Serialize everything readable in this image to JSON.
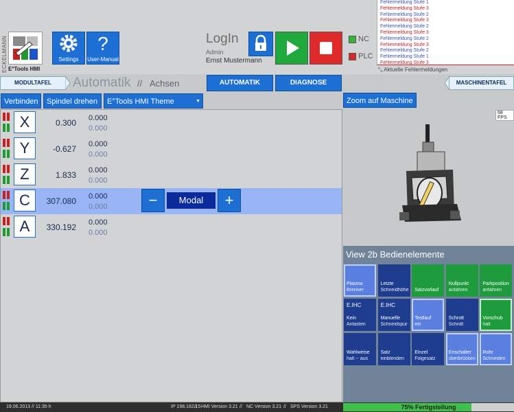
{
  "brand": {
    "vertical": "ECKELMANN",
    "name": "E°Tools HMI"
  },
  "toolbar": {
    "settings_label": "Settings",
    "manual_label": "User-Manual"
  },
  "login": {
    "title": "LogIn",
    "role": "Admin",
    "user": "Ernst Mustermann"
  },
  "indicators": {
    "nc_label": "NC",
    "plc_label": "PLC",
    "nc_color": "#35b43c",
    "plc_color": "#d82a2a"
  },
  "errors": {
    "items": [
      {
        "text": "Fehlermeldung Stufe 1",
        "level": 1
      },
      {
        "text": "Fehlermeldung Stufe 3",
        "level": 3
      },
      {
        "text": "Fehlermeldung Stufe 2",
        "level": 2
      },
      {
        "text": "Fehlermeldung Stufe 3",
        "level": 3
      },
      {
        "text": "Fehlermeldung Stufe 2",
        "level": 2
      },
      {
        "text": "Fehlermeldung Stufe 3",
        "level": 3
      },
      {
        "text": "Fehlermeldung Stufe 2",
        "level": 2
      },
      {
        "text": "Fehlermeldung Stufe 3",
        "level": 3
      },
      {
        "text": "Fehlermeldung Stufe 2",
        "level": 2
      },
      {
        "text": "Fehlermeldung Stufe 1",
        "level": 1
      },
      {
        "text": "Fehlermeldung Stufe 3",
        "level": 3
      }
    ],
    "footer": "Aktuelle Fehlermeldungen",
    "colors": {
      "1": "#3a50b0",
      "2": "#3a50b0",
      "3": "#c0202a"
    }
  },
  "nav": {
    "modultafel": "MODULTAFEL",
    "crumb_main": "Automatik",
    "crumb_sep": "//",
    "crumb_sub": "Achsen",
    "tab_automatik": "AUTOMATIK",
    "tab_diagnose": "DIAGNOSE",
    "maschinentafel": "MASCHINENTAFEL"
  },
  "controls": {
    "connect": "Verbinden",
    "spindle": "Spindel drehen",
    "theme": "E°Tools HMI Theme",
    "zoom": "Zoom auf Maschine"
  },
  "axes": [
    {
      "name": "X",
      "value": "0.300",
      "s1": "0.000",
      "s2": "0.000",
      "active": false
    },
    {
      "name": "Y",
      "value": "-0.627",
      "s1": "0.000",
      "s2": "0.000",
      "active": false
    },
    {
      "name": "Z",
      "value": "1.833",
      "s1": "0.000",
      "s2": "0.000",
      "active": false
    },
    {
      "name": "C",
      "value": "307.080",
      "s1": "0.000",
      "s2": "0.000",
      "active": true
    },
    {
      "name": "A",
      "value": "330.192",
      "s1": "0.000",
      "s2": "0.000",
      "active": false
    }
  ],
  "modal": {
    "minus": "−",
    "label": "Modal",
    "plus": "+"
  },
  "machine": {
    "fps": "68 FPS"
  },
  "bedien": {
    "title": "View 2b Bedienelemente",
    "tiles": [
      {
        "top": "",
        "l1": "Plasma",
        "l2": "Brenner",
        "bg": "#5a7fe0",
        "border": "#bcd0ff"
      },
      {
        "top": "",
        "l1": "Letzte",
        "l2": "Schneidhöhe",
        "bg": "#1f3d8f",
        "border": "#1f3d8f"
      },
      {
        "top": "",
        "l1": "Satzvorlauf",
        "l2": "",
        "bg": "#1e9b3c",
        "border": "#1e9b3c"
      },
      {
        "top": "",
        "l1": "Nullpunkt",
        "l2": "anfahren",
        "bg": "#1e9b3c",
        "border": "#1e9b3c"
      },
      {
        "top": "",
        "l1": "Parkposition",
        "l2": "anfahren",
        "bg": "#1e9b3c",
        "border": "#1e9b3c"
      },
      {
        "top": "E.IHC",
        "l1": "Kein",
        "l2": "Antasten",
        "bg": "#1f3d8f",
        "border": "#1f3d8f"
      },
      {
        "top": "E.IHC",
        "l1": "Manuelle",
        "l2": "Schneidspur",
        "bg": "#1f3d8f",
        "border": "#1f3d8f"
      },
      {
        "top": "",
        "l1": "Testlauf",
        "l2": "ein",
        "bg": "#5a7fe0",
        "border": "#bcd0ff"
      },
      {
        "top": "",
        "l1": "Schrott",
        "l2": "Schnitt",
        "bg": "#1f3d8f",
        "border": "#1f3d8f"
      },
      {
        "top": "",
        "l1": "Vorschub",
        "l2": "halt",
        "bg": "#1e9b3c",
        "border": "#bff0c8"
      },
      {
        "top": "",
        "l1": "Wahlweise",
        "l2": "halt -- aus",
        "bg": "#1f3d8f",
        "border": "#1f3d8f"
      },
      {
        "top": "",
        "l1": "Satz",
        "l2": "einblenden",
        "bg": "#1f3d8f",
        "border": "#1f3d8f"
      },
      {
        "top": "",
        "l1": "Einzel",
        "l2": "Folgesatz",
        "bg": "#1f3d8f",
        "border": "#1f3d8f"
      },
      {
        "top": "",
        "l1": "Enschalter",
        "l2": "überbrücken",
        "bg": "#5a7fe0",
        "border": "#bcd0ff"
      },
      {
        "top": "",
        "l1": "Rohr",
        "l2": "Schneiden",
        "bg": "#5a7fe0",
        "border": "#bcd0ff"
      }
    ]
  },
  "status": {
    "datetime": "19.06.2013 // 11:35 h",
    "ip": "IP 198.162.15",
    "hmi": "HMI Version 3.21",
    "nc": "NC Version 3.21",
    "sps": "SPS Version 3.21",
    "sep": "//",
    "progress_label": "75% Fertigstellung",
    "progress": 0.75
  }
}
